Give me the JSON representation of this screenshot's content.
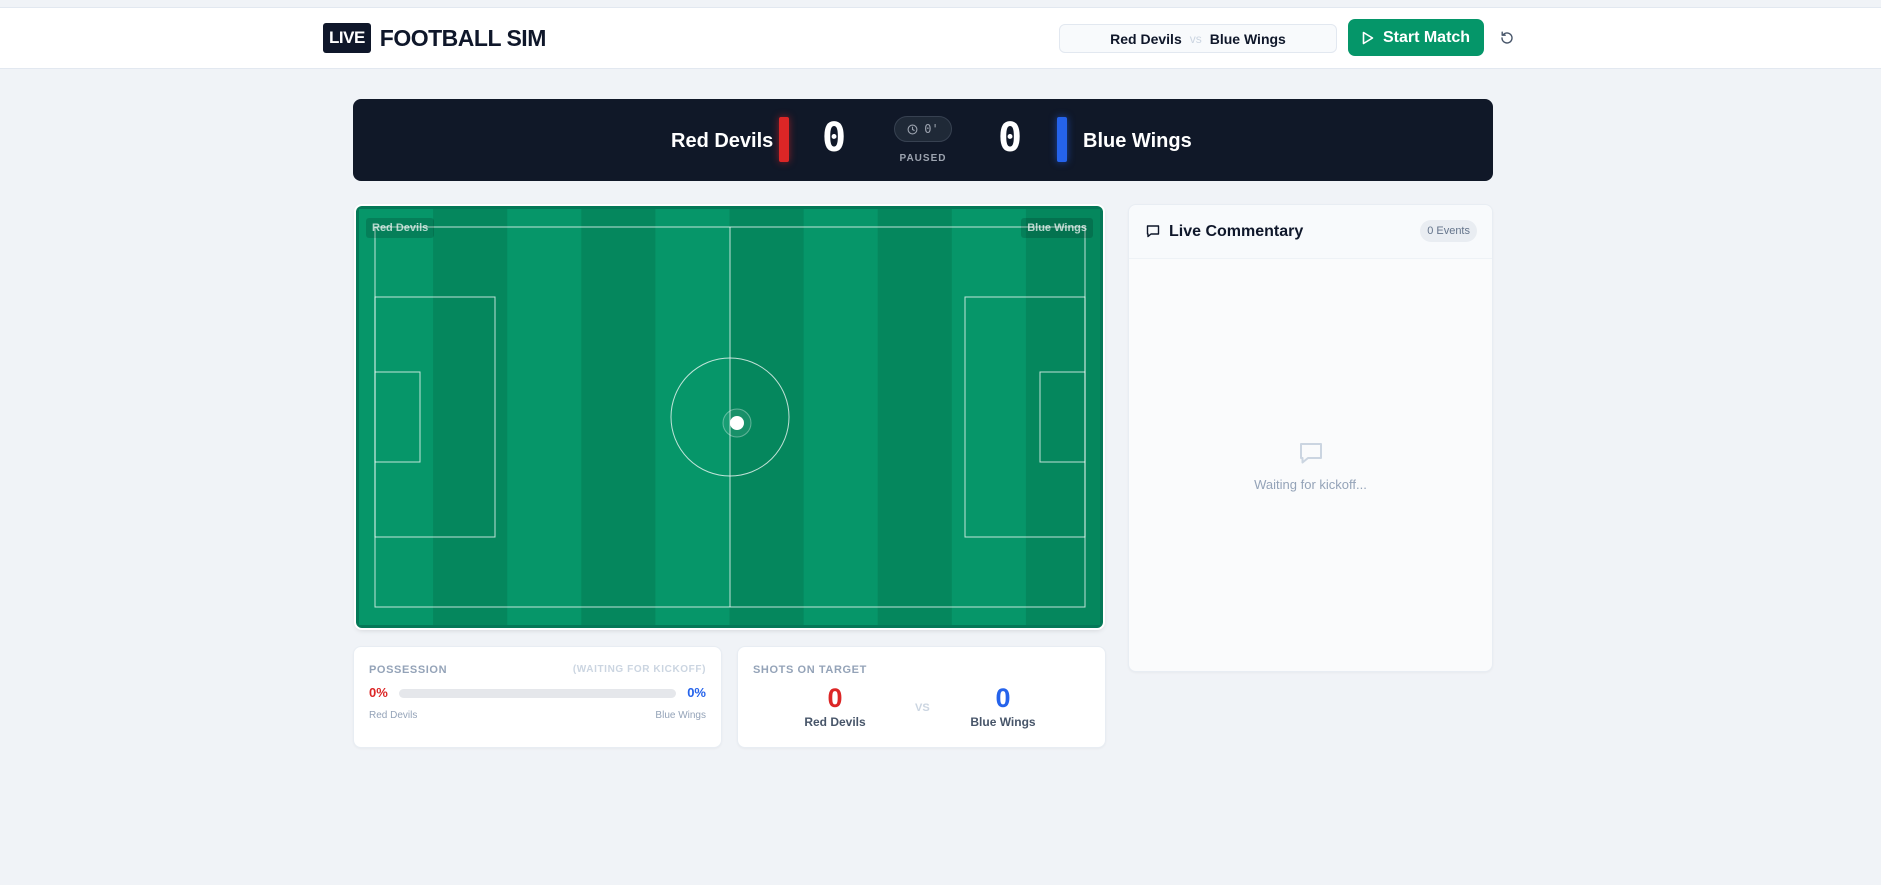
{
  "header": {
    "live_badge": "LIVE",
    "title": "FOOTBALL SIM",
    "matchup": {
      "home": "Red Devils",
      "vs": "vs",
      "away": "Blue Wings"
    },
    "start_label": "Start Match"
  },
  "scoreboard": {
    "home_name": "Red Devils",
    "away_name": "Blue Wings",
    "home_score": "0",
    "away_score": "0",
    "clock": "0'",
    "status": "PAUSED",
    "home_color": "#dc2626",
    "away_color": "#2563eb"
  },
  "pitch": {
    "home_label": "Red Devils",
    "away_label": "Blue Wings",
    "grass_light": "#069669",
    "grass_dark": "#05875d"
  },
  "possession": {
    "title": "POSSESSION",
    "note": "(WAITING FOR KICKOFF)",
    "home_pct_text": "0%",
    "away_pct_text": "0%",
    "home_fraction": 0,
    "home_name": "Red Devils",
    "away_name": "Blue Wings"
  },
  "shots": {
    "title": "SHOTS ON TARGET",
    "home_value": "0",
    "away_value": "0",
    "vs": "VS",
    "home_name": "Red Devils",
    "away_name": "Blue Wings"
  },
  "commentary": {
    "title": "Live Commentary",
    "count": "0 Events",
    "empty_text": "Waiting for kickoff..."
  },
  "icons": {
    "start": "play-icon",
    "reset": "reset-icon",
    "clock": "clock-icon",
    "commentary": "chat-icon"
  }
}
